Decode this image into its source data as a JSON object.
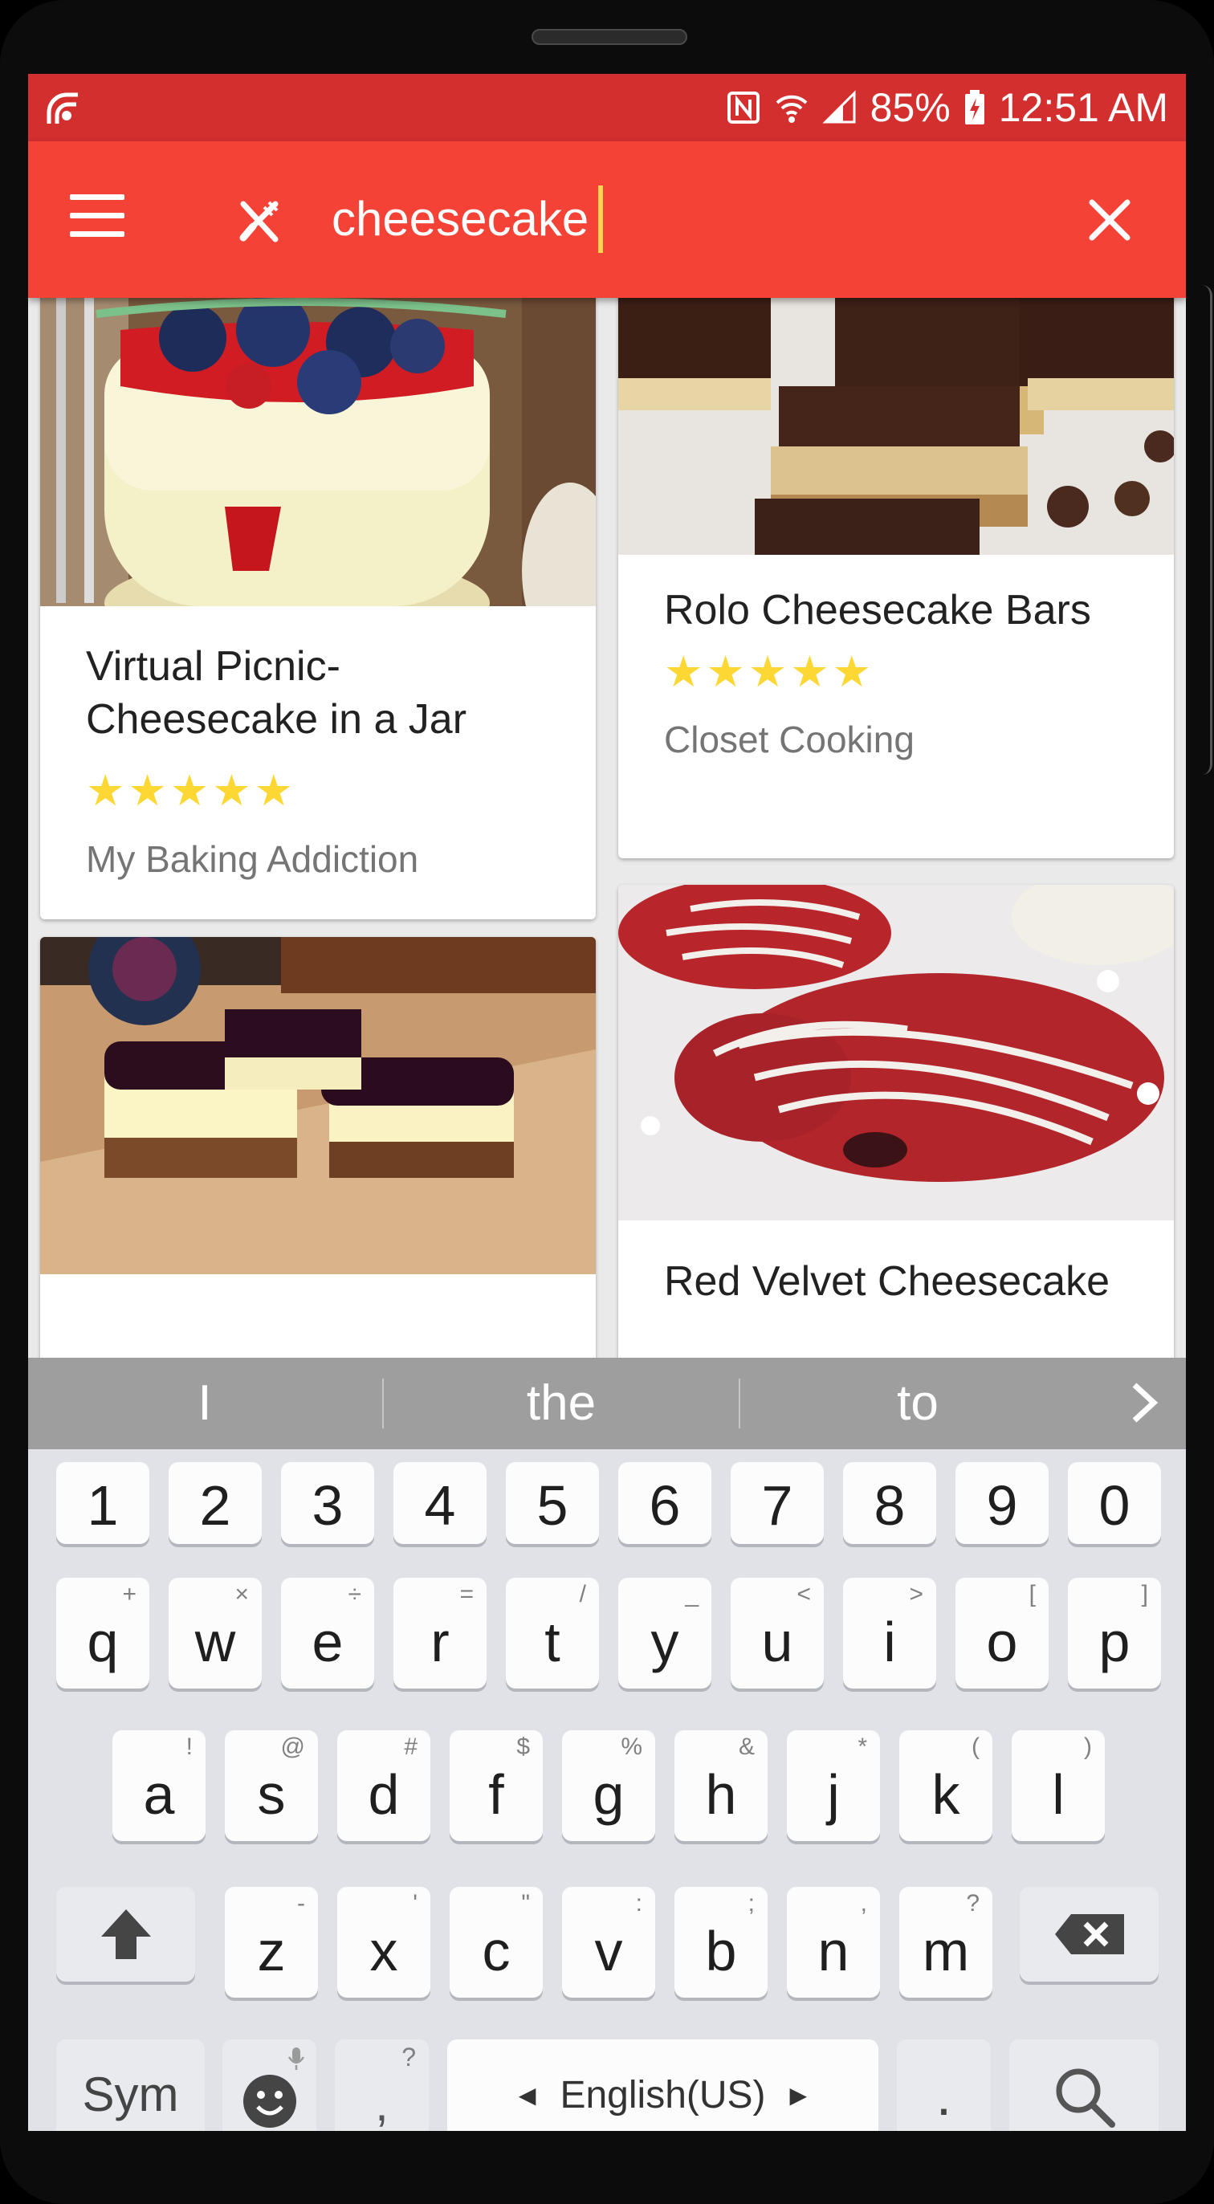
{
  "status_bar": {
    "battery": "85%",
    "time": "12:51 AM"
  },
  "search": {
    "query": "cheesecake"
  },
  "cards": [
    {
      "title": "Virtual Picnic- Cheesecake in a Jar",
      "rating": "★★★★★",
      "source": "My Baking Addiction"
    },
    {
      "title": "Rolo Cheesecake Bars",
      "rating": "★★★★★",
      "source": "Closet Cooking"
    },
    {
      "title": "Red Velvet Cheesecake"
    }
  ],
  "keyboard": {
    "suggestions": [
      "I",
      "the",
      "to"
    ],
    "number_row": [
      "1",
      "2",
      "3",
      "4",
      "5",
      "6",
      "7",
      "8",
      "9",
      "0"
    ],
    "row1": [
      {
        "k": "q",
        "s": "+"
      },
      {
        "k": "w",
        "s": "×"
      },
      {
        "k": "e",
        "s": "÷"
      },
      {
        "k": "r",
        "s": "="
      },
      {
        "k": "t",
        "s": "/"
      },
      {
        "k": "y",
        "s": "_"
      },
      {
        "k": "u",
        "s": "<"
      },
      {
        "k": "i",
        "s": ">"
      },
      {
        "k": "o",
        "s": "["
      },
      {
        "k": "p",
        "s": "]"
      }
    ],
    "row2": [
      {
        "k": "a",
        "s": "!"
      },
      {
        "k": "s",
        "s": "@"
      },
      {
        "k": "d",
        "s": "#"
      },
      {
        "k": "f",
        "s": "$"
      },
      {
        "k": "g",
        "s": "%"
      },
      {
        "k": "h",
        "s": "&"
      },
      {
        "k": "j",
        "s": "*"
      },
      {
        "k": "k",
        "s": "("
      },
      {
        "k": "l",
        "s": ")"
      }
    ],
    "row3": [
      {
        "k": "z",
        "s": "-"
      },
      {
        "k": "x",
        "s": "'"
      },
      {
        "k": "c",
        "s": "\""
      },
      {
        "k": "v",
        "s": ":"
      },
      {
        "k": "b",
        "s": ";"
      },
      {
        "k": "n",
        "s": ","
      },
      {
        "k": "m",
        "s": "?"
      }
    ],
    "sym_label": "Sym",
    "comma": ",",
    "comma_sub": "?",
    "language": "English(US)",
    "period": "."
  },
  "colors": {
    "status_bar": "#d32f2f",
    "app_bar": "#f44336",
    "caret": "#ffd54f",
    "star": "#fdd835"
  }
}
